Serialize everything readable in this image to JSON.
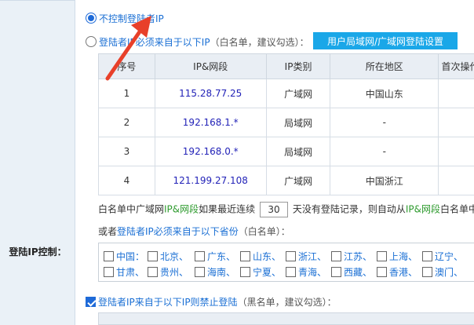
{
  "left": {
    "label": "登陆IP控制："
  },
  "options": {
    "no_control": "不控制登陆者IP",
    "whitelist_blue": "登陆者IP必须来自于以下IP",
    "whitelist_gray": "（白名单，建议勾选）：",
    "setting_button": "用户局域网/广域网登陆设置"
  },
  "table": {
    "headers": [
      "序号",
      "IP&网段",
      "IP类别",
      "所在地区",
      "首次操作"
    ],
    "rows": [
      {
        "no": "1",
        "ip": "115.28.77.25",
        "type": "广域网",
        "region": "中国山东"
      },
      {
        "no": "2",
        "ip": "192.168.1.*",
        "type": "局域网",
        "region": "-"
      },
      {
        "no": "3",
        "ip": "192.168.0.*",
        "type": "局域网",
        "region": "-"
      },
      {
        "no": "4",
        "ip": "121.199.27.108",
        "type": "广域网",
        "region": "中国浙江"
      }
    ]
  },
  "repeat": {
    "prefix": "白名单中广域网",
    "green": "IP&网段",
    "mid": "如果最近连续",
    "days": "30",
    "suffix": "天没有登陆记录，则自动从",
    "green2": "IP&网段",
    "tail": "白名单中"
  },
  "province": {
    "title_prefix": "或者",
    "title_blue": "登陆者IP必须来自于以下省份",
    "title_gray": "（白名单）：",
    "row1": [
      "中国：",
      "北京、",
      "广东、",
      "山东、",
      "浙江、",
      "江苏、",
      "上海、",
      "辽宁、"
    ],
    "row2": [
      "甘肃、",
      "贵州、",
      "海南、",
      "宁夏、",
      "青海、",
      "西藏、",
      "香港、",
      "澳门、"
    ]
  },
  "blacklist": {
    "blue": "登陆者IP来自于以下IP则禁止登陆",
    "gray": "（黑名单，建议勾选）："
  },
  "colors": {
    "accent": "#1a6fd4",
    "button": "#1aa7e8",
    "arrow": "#e8402a"
  }
}
